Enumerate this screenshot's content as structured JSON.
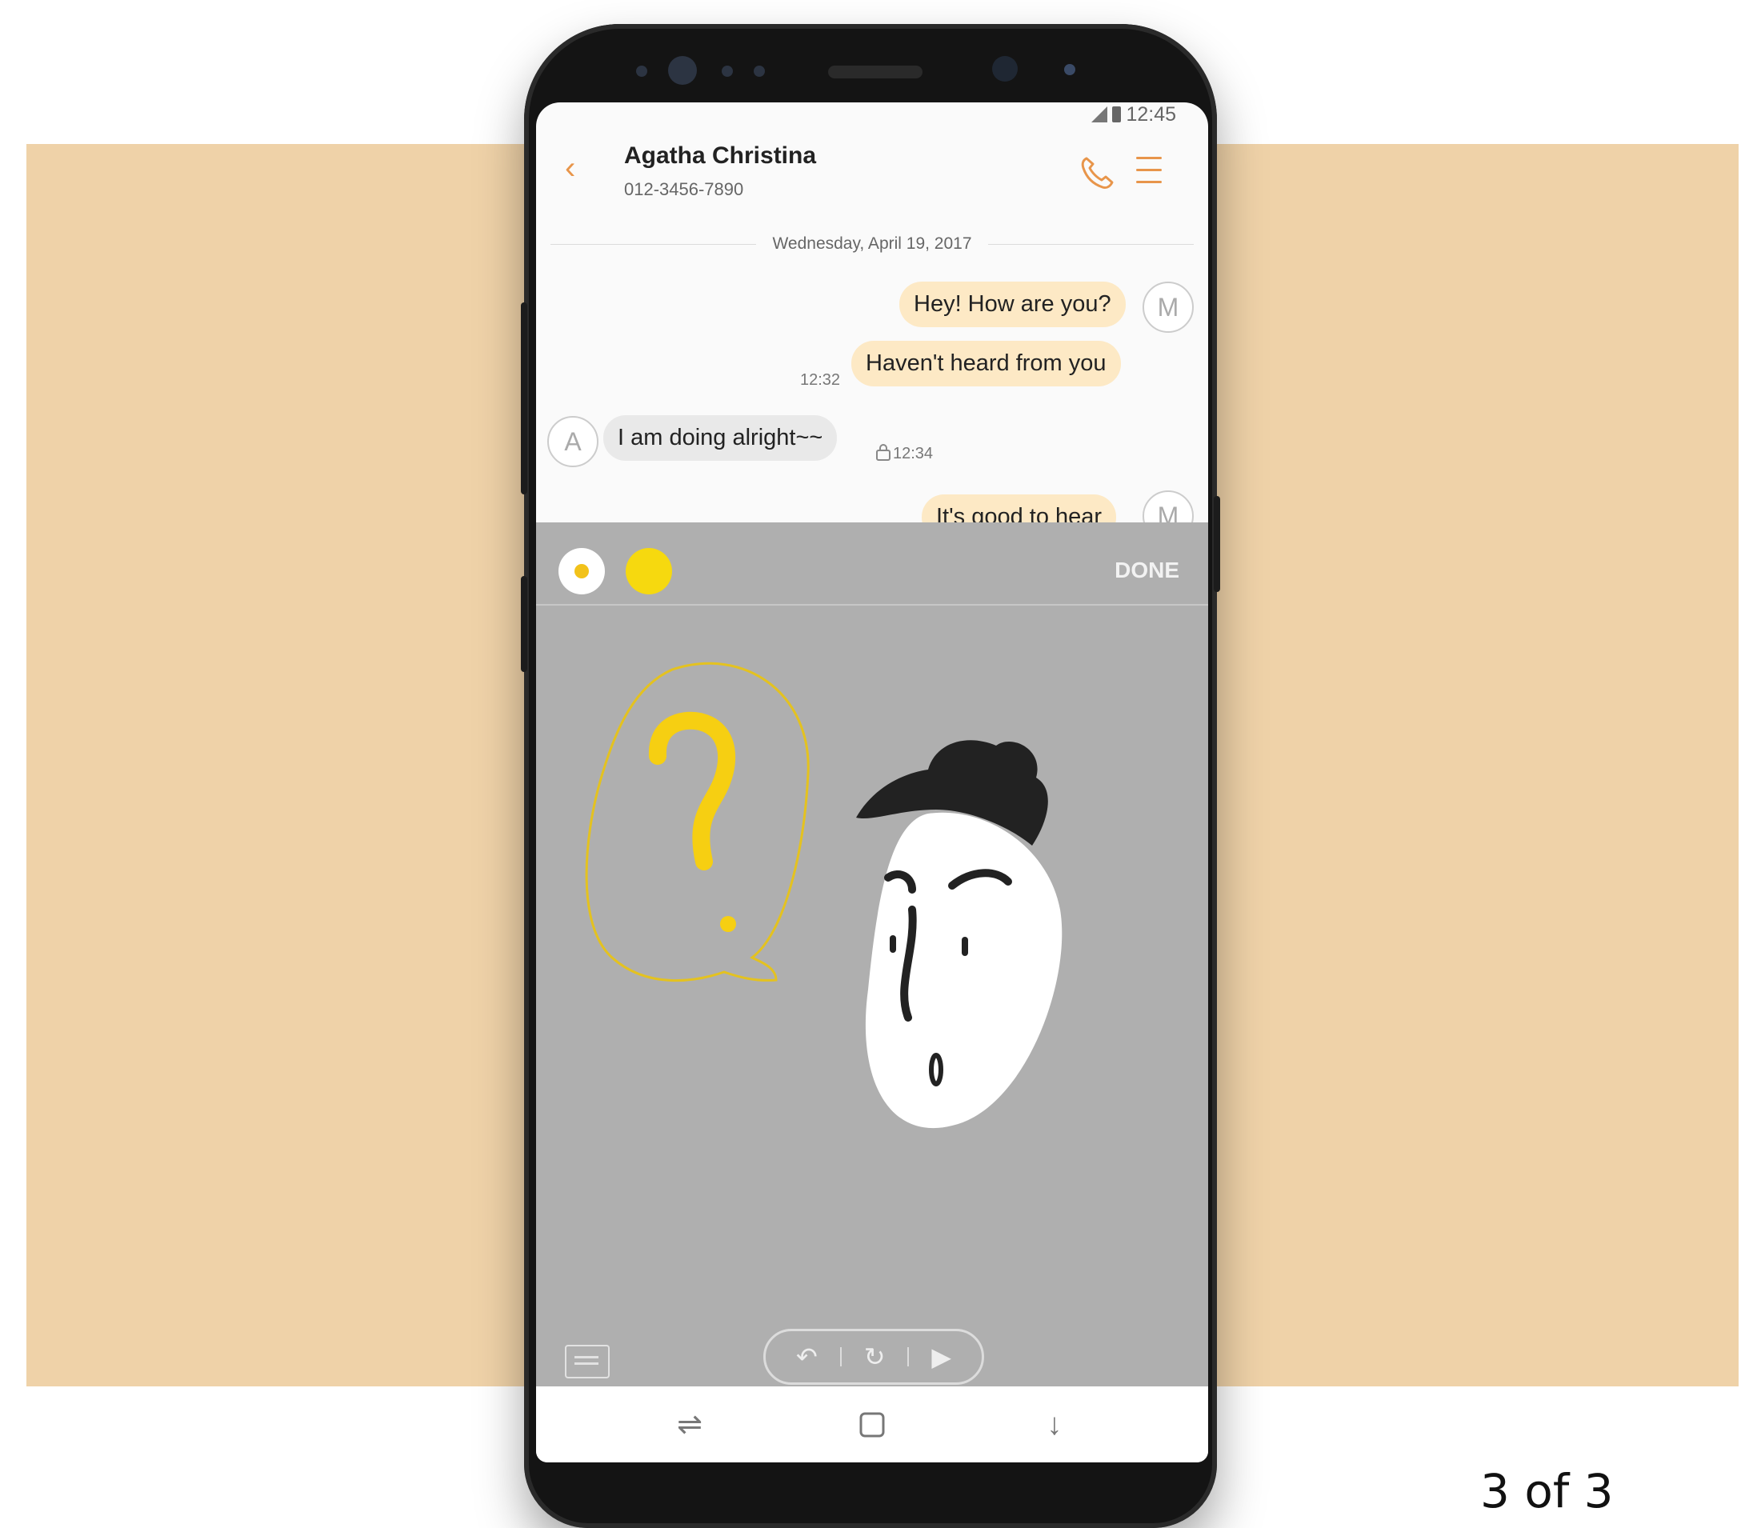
{
  "status_bar": {
    "time": "12:45"
  },
  "header": {
    "contact_name": "Agatha Christina",
    "contact_number": "012-3456-7890"
  },
  "conversation": {
    "date_separator": "Wednesday, April 19, 2017",
    "messages": [
      {
        "direction": "outgoing",
        "text": "Hey! How are you?",
        "avatar": "M"
      },
      {
        "direction": "outgoing",
        "text": "Haven't heard from you",
        "time": "12:32"
      },
      {
        "direction": "incoming",
        "text": "I am doing alright~~",
        "avatar": "A",
        "time": "12:34"
      },
      {
        "direction": "outgoing",
        "text": "It's good to hear",
        "avatar": "M"
      }
    ]
  },
  "drawing": {
    "done_label": "DONE",
    "pen_color": "#f6d90f",
    "controls": [
      "undo-icon",
      "replay-icon",
      "play-icon"
    ]
  },
  "nav_bar": {
    "buttons": [
      "recent-apps-icon",
      "home-icon",
      "back-icon"
    ]
  },
  "pager": "3 of 3",
  "colors": {
    "accent": "#e8954a",
    "backdrop": "#efd2a8",
    "outgoing_bubble": "#fde9c5",
    "drawing_overlay": "#afafaf"
  }
}
